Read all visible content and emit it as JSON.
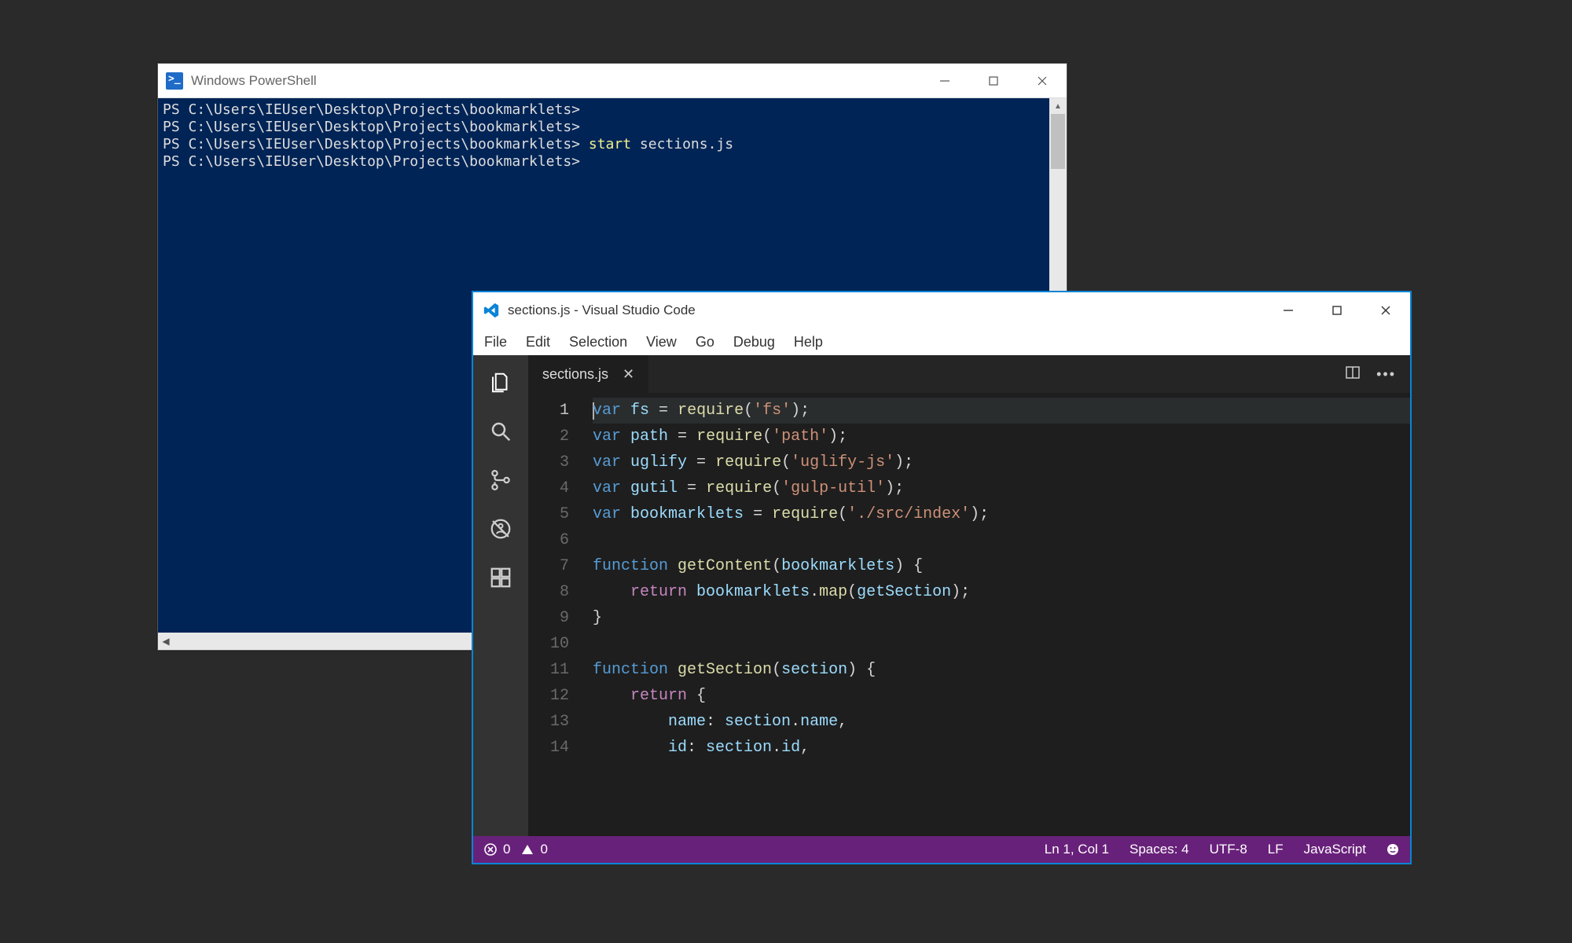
{
  "powershell": {
    "title": "Windows PowerShell",
    "prompt": "PS C:\\Users\\IEUser\\Desktop\\Projects\\bookmarklets>",
    "lines": [
      {
        "cmd": "",
        "arg": ""
      },
      {
        "cmd": "",
        "arg": ""
      },
      {
        "cmd": "start",
        "arg": "sections.js"
      },
      {
        "cmd": "",
        "arg": ""
      }
    ]
  },
  "vscode": {
    "title": "sections.js - Visual Studio Code",
    "menu": [
      "File",
      "Edit",
      "Selection",
      "View",
      "Go",
      "Debug",
      "Help"
    ],
    "tab": {
      "label": "sections.js"
    },
    "activity_icons": [
      "files-icon",
      "search-icon",
      "source-control-icon",
      "debug-icon",
      "extensions-icon"
    ],
    "code": [
      [
        {
          "t": "kw",
          "v": "var"
        },
        {
          "t": "punc",
          "v": " "
        },
        {
          "t": "id",
          "v": "fs"
        },
        {
          "t": "punc",
          "v": " = "
        },
        {
          "t": "fn",
          "v": "require"
        },
        {
          "t": "punc",
          "v": "("
        },
        {
          "t": "str",
          "v": "'fs'"
        },
        {
          "t": "punc",
          "v": ");"
        }
      ],
      [
        {
          "t": "kw",
          "v": "var"
        },
        {
          "t": "punc",
          "v": " "
        },
        {
          "t": "id",
          "v": "path"
        },
        {
          "t": "punc",
          "v": " = "
        },
        {
          "t": "fn",
          "v": "require"
        },
        {
          "t": "punc",
          "v": "("
        },
        {
          "t": "str",
          "v": "'path'"
        },
        {
          "t": "punc",
          "v": ");"
        }
      ],
      [
        {
          "t": "kw",
          "v": "var"
        },
        {
          "t": "punc",
          "v": " "
        },
        {
          "t": "id",
          "v": "uglify"
        },
        {
          "t": "punc",
          "v": " = "
        },
        {
          "t": "fn",
          "v": "require"
        },
        {
          "t": "punc",
          "v": "("
        },
        {
          "t": "str",
          "v": "'uglify-js'"
        },
        {
          "t": "punc",
          "v": ");"
        }
      ],
      [
        {
          "t": "kw",
          "v": "var"
        },
        {
          "t": "punc",
          "v": " "
        },
        {
          "t": "id",
          "v": "gutil"
        },
        {
          "t": "punc",
          "v": " = "
        },
        {
          "t": "fn",
          "v": "require"
        },
        {
          "t": "punc",
          "v": "("
        },
        {
          "t": "str",
          "v": "'gulp-util'"
        },
        {
          "t": "punc",
          "v": ");"
        }
      ],
      [
        {
          "t": "kw",
          "v": "var"
        },
        {
          "t": "punc",
          "v": " "
        },
        {
          "t": "id",
          "v": "bookmarklets"
        },
        {
          "t": "punc",
          "v": " = "
        },
        {
          "t": "fn",
          "v": "require"
        },
        {
          "t": "punc",
          "v": "("
        },
        {
          "t": "str",
          "v": "'./src/index'"
        },
        {
          "t": "punc",
          "v": ");"
        }
      ],
      [],
      [
        {
          "t": "kw",
          "v": "function"
        },
        {
          "t": "punc",
          "v": " "
        },
        {
          "t": "fn",
          "v": "getContent"
        },
        {
          "t": "punc",
          "v": "("
        },
        {
          "t": "id",
          "v": "bookmarklets"
        },
        {
          "t": "punc",
          "v": ") {"
        }
      ],
      [
        {
          "t": "punc",
          "v": "    "
        },
        {
          "t": "ctl",
          "v": "return"
        },
        {
          "t": "punc",
          "v": " "
        },
        {
          "t": "id",
          "v": "bookmarklets"
        },
        {
          "t": "punc",
          "v": "."
        },
        {
          "t": "fn",
          "v": "map"
        },
        {
          "t": "punc",
          "v": "("
        },
        {
          "t": "id",
          "v": "getSection"
        },
        {
          "t": "punc",
          "v": ");"
        }
      ],
      [
        {
          "t": "punc",
          "v": "}"
        }
      ],
      [],
      [
        {
          "t": "kw",
          "v": "function"
        },
        {
          "t": "punc",
          "v": " "
        },
        {
          "t": "fn",
          "v": "getSection"
        },
        {
          "t": "punc",
          "v": "("
        },
        {
          "t": "id",
          "v": "section"
        },
        {
          "t": "punc",
          "v": ") {"
        }
      ],
      [
        {
          "t": "punc",
          "v": "    "
        },
        {
          "t": "ctl",
          "v": "return"
        },
        {
          "t": "punc",
          "v": " {"
        }
      ],
      [
        {
          "t": "punc",
          "v": "        "
        },
        {
          "t": "id",
          "v": "name"
        },
        {
          "t": "punc",
          "v": ": "
        },
        {
          "t": "id",
          "v": "section"
        },
        {
          "t": "punc",
          "v": "."
        },
        {
          "t": "id",
          "v": "name"
        },
        {
          "t": "punc",
          "v": ","
        }
      ],
      [
        {
          "t": "punc",
          "v": "        "
        },
        {
          "t": "id",
          "v": "id"
        },
        {
          "t": "punc",
          "v": ": "
        },
        {
          "t": "id",
          "v": "section"
        },
        {
          "t": "punc",
          "v": "."
        },
        {
          "t": "id",
          "v": "id"
        },
        {
          "t": "punc",
          "v": ","
        }
      ]
    ],
    "current_line": 1,
    "status": {
      "errors": "0",
      "warnings": "0",
      "position": "Ln 1, Col 1",
      "spaces": "Spaces: 4",
      "encoding": "UTF-8",
      "eol": "LF",
      "language": "JavaScript"
    }
  }
}
